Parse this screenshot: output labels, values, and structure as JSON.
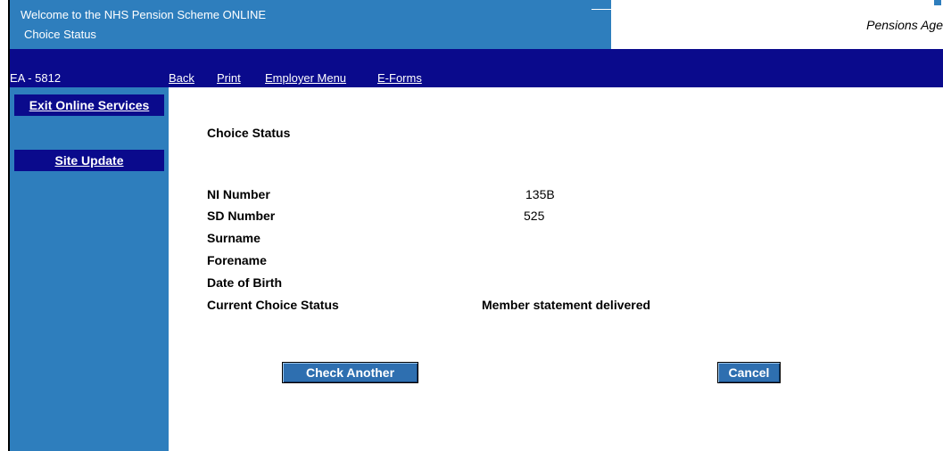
{
  "banner": {
    "title": "Welcome to the NHS Pension Scheme ONLINE",
    "subtitle": "Choice Status",
    "org_name": "Pensions Age"
  },
  "menu": {
    "employer_code": "EA - 5812",
    "links": [
      "Back",
      "Print",
      "Employer Menu",
      "E-Forms"
    ]
  },
  "sidebar": {
    "items": [
      "Exit Online Services",
      "Site Update"
    ]
  },
  "main": {
    "heading": "Choice Status",
    "fields": [
      {
        "label": "NI Number",
        "value": "135B"
      },
      {
        "label": "SD Number",
        "value": "525"
      },
      {
        "label": "Surname",
        "value": ""
      },
      {
        "label": "Forename",
        "value": ""
      },
      {
        "label": "Date of Birth",
        "value": ""
      },
      {
        "label": "Current Choice Status",
        "value": "Member statement delivered"
      }
    ],
    "buttons": {
      "check_another": "Check Another",
      "cancel": "Cancel"
    }
  },
  "colors": {
    "banner_blue": "#2e7ebd",
    "navy": "#0a0a8c",
    "sidebar_blue": "#2e7ebd",
    "button_blue": "#2e6fb0"
  }
}
